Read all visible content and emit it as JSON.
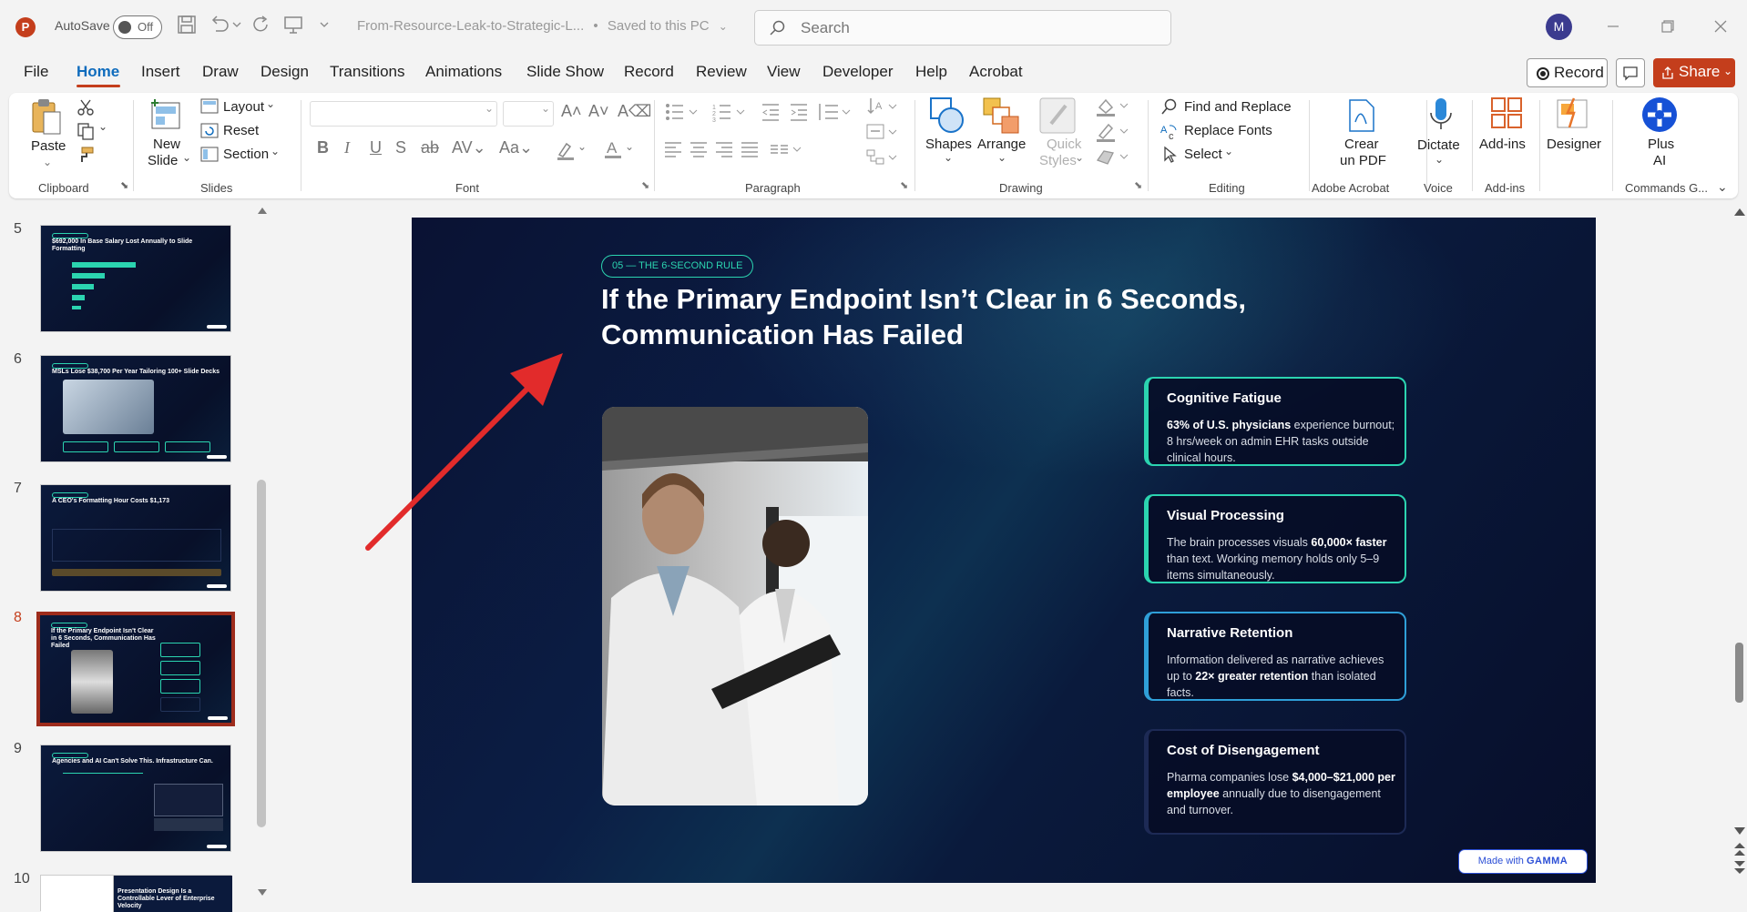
{
  "titlebar": {
    "app_badge": "P",
    "autosave_label": "AutoSave",
    "autosave_state": "Off",
    "document_title": "From-Resource-Leak-to-Strategic-L...",
    "save_status": "Saved to this PC",
    "search_placeholder": "Search",
    "user_initial": "M"
  },
  "menu": {
    "tabs": [
      "File",
      "Home",
      "Insert",
      "Draw",
      "Design",
      "Transitions",
      "Animations",
      "Slide Show",
      "Record",
      "Review",
      "View",
      "Developer",
      "Help",
      "Acrobat"
    ],
    "active": "Home",
    "record_label": "Record",
    "share_label": "Share"
  },
  "ribbon": {
    "clipboard": {
      "label": "Clipboard",
      "paste": "Paste"
    },
    "slides": {
      "label": "Slides",
      "new_slide_1": "New",
      "new_slide_2": "Slide",
      "layout": "Layout",
      "reset": "Reset",
      "section": "Section"
    },
    "font": {
      "label": "Font"
    },
    "paragraph": {
      "label": "Paragraph"
    },
    "drawing": {
      "label": "Drawing",
      "shapes": "Shapes",
      "arrange": "Arrange",
      "quick_styles_1": "Quick",
      "quick_styles_2": "Styles"
    },
    "editing": {
      "label": "Editing",
      "find_replace": "Find and Replace",
      "replace_fonts": "Replace Fonts",
      "select": "Select"
    },
    "adobe": {
      "label": "Adobe Acrobat",
      "crear_1": "Crear",
      "crear_2": "un PDF"
    },
    "voice": {
      "label": "Voice",
      "dictate": "Dictate"
    },
    "addins": {
      "label": "Add-ins",
      "addins_btn": "Add-ins"
    },
    "designer": {
      "label": "Designer"
    },
    "commands": {
      "label": "Commands G...",
      "plus_1": "Plus",
      "plus_2": "AI"
    }
  },
  "slides_panel": {
    "selected": "8",
    "items": [
      {
        "num": "5",
        "title": "$692,000 In Base Salary Lost Annually to Slide Formatting"
      },
      {
        "num": "6",
        "title": "MSLs Lose $38,700 Per Year Tailoring 100+ Slide Decks"
      },
      {
        "num": "7",
        "title": "A CEO's Formatting Hour Costs $1,173"
      },
      {
        "num": "8",
        "title": "If the Primary Endpoint Isn't Clear in 6 Seconds, Communication Has Failed"
      },
      {
        "num": "9",
        "title": "Agencies and AI Can't Solve This. Infrastructure Can."
      },
      {
        "num": "10",
        "title": "Presentation Design Is a Controllable Lever of Enterprise Velocity"
      }
    ]
  },
  "slide": {
    "tag": "05 — THE 6-SECOND RULE",
    "title_line1": "If the Primary Endpoint Isn’t Clear in 6 Seconds,",
    "title_line2": "Communication Has Failed",
    "cards": [
      {
        "title": "Cognitive Fatigue",
        "bold": "63% of U.S. physicians",
        "text": " experience burnout; 8 hrs/week on admin EHR tasks outside clinical hours."
      },
      {
        "title": "Visual Processing",
        "pre": "The brain processes visuals ",
        "bold": "60,000× faster",
        "text": " than text. Working memory holds only 5–9 items simultaneously."
      },
      {
        "title": "Narrative Retention",
        "pre": "Information delivered as narrative achieves up to ",
        "bold": "22× greater retention",
        "text": " than isolated facts."
      },
      {
        "title": "Cost of Disengagement",
        "pre": "Pharma companies lose ",
        "bold": "$4,000–$21,000 per employee",
        "text": " annually due to disengagement and turnover."
      }
    ],
    "badge_prefix": "Made with",
    "badge_brand": "GAMMA"
  },
  "colors": {
    "accent": "#c43e1c",
    "teal": "#2bd4b0",
    "active_tab": "#0f6cbd",
    "slide_bg": "#0a1233"
  }
}
